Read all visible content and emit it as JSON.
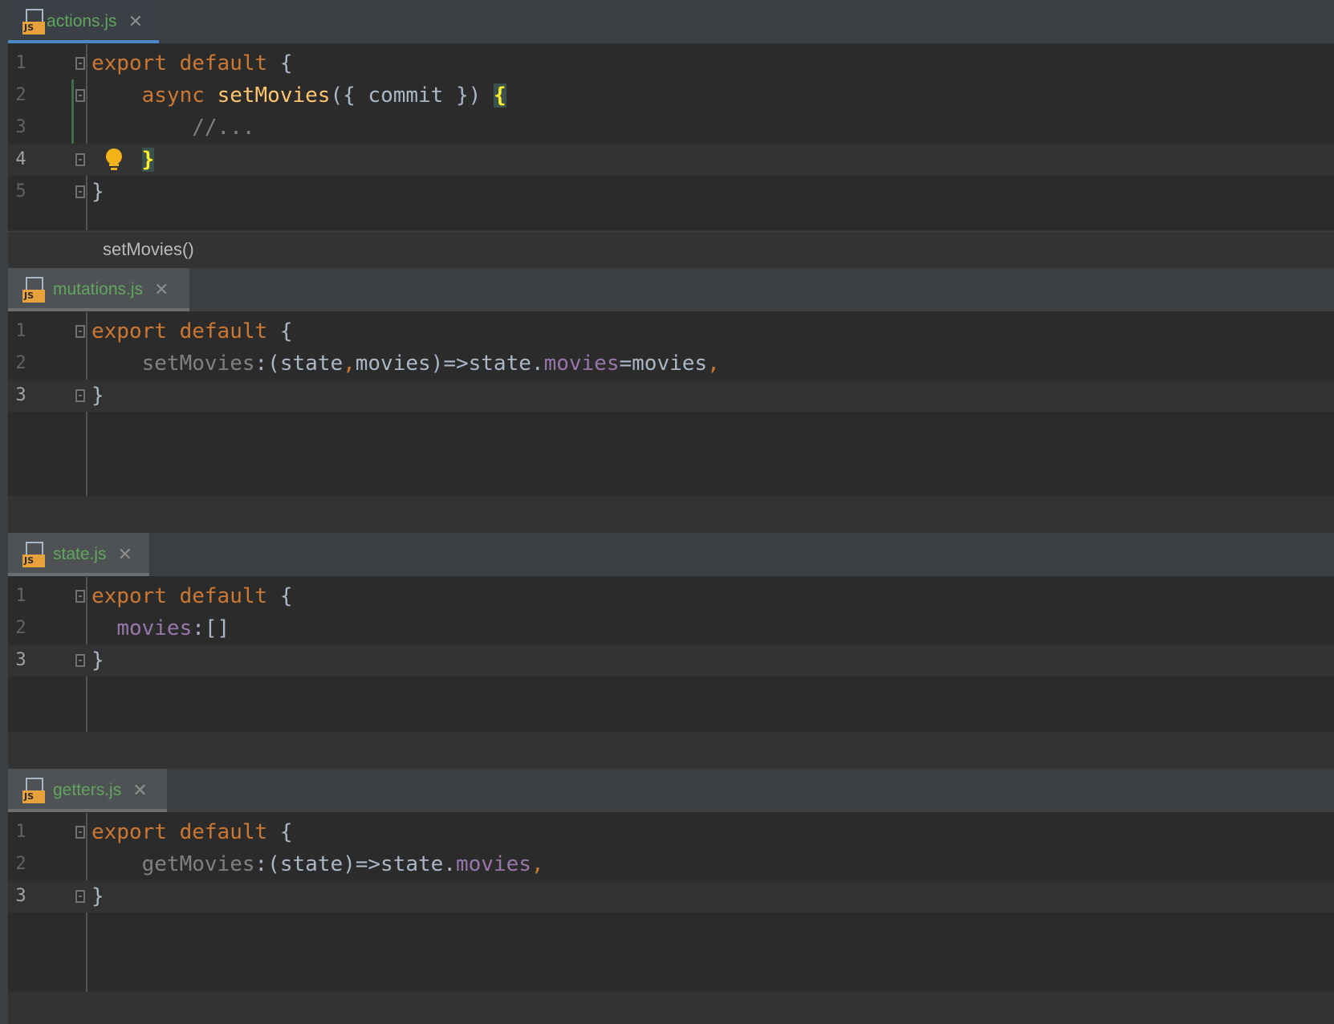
{
  "panes": [
    {
      "file": "actions.js",
      "lines": [
        "1",
        "2",
        "3",
        "4",
        "5"
      ],
      "breadcrumb": "setMovies()"
    },
    {
      "file": "mutations.js",
      "lines": [
        "1",
        "2",
        "3"
      ]
    },
    {
      "file": "state.js",
      "lines": [
        "1",
        "2",
        "3"
      ]
    },
    {
      "file": "getters.js",
      "lines": [
        "1",
        "2",
        "3"
      ]
    }
  ],
  "tokens": {
    "export": "export",
    "default": "default",
    "open_brace": "{",
    "close_brace": "}",
    "async": "async",
    "setMovies": "setMovies",
    "commit_params": "({ commit })",
    "comment": "//...",
    "mut_key": "setMovies",
    "mut_colon": ":",
    "mut_params_a": "(state",
    "mut_comma": ",",
    "mut_params_b": "movies)=>state.",
    "mut_prop": "movies",
    "mut_assign": "=movies",
    "mut_trailing": ",",
    "state_key": "movies",
    "state_val": ":[]",
    "get_key": "getMovies",
    "get_colon": ":",
    "get_body": "(state)=>state.",
    "get_prop": "movies",
    "get_trailing": ","
  },
  "icons": {
    "file_badge": "JS",
    "close": "✕"
  },
  "colors": {
    "keyword": "#cc7832",
    "function": "#ffc66d",
    "property": "#9876aa",
    "text": "#a9b7c6",
    "file_name": "#62a55f",
    "active_tab_underline": "#4a88c7"
  }
}
